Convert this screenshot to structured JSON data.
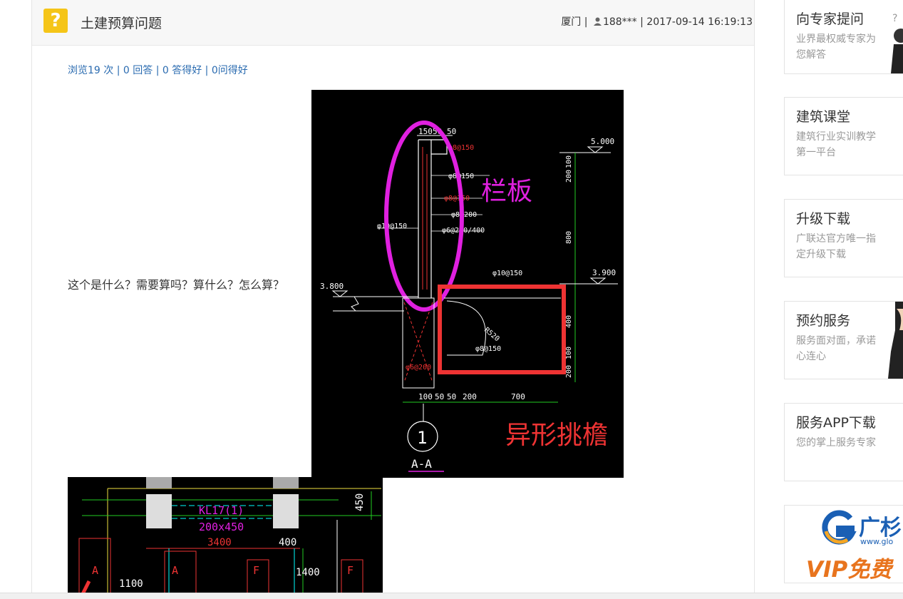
{
  "question": {
    "title": "土建预算问题",
    "location": "厦门",
    "separator1": "|",
    "user": "188***",
    "separator2": "|",
    "datetime": "2017-09-14 16:19:13",
    "stats": "浏览19 次 | 0 回答 | 0 答得好 | 0问得好",
    "body_text": "这个是什么？需要算吗？算什么？怎么算？"
  },
  "drawing1": {
    "label_railing": "栏板",
    "label_eave": "异形挑檐",
    "section": "A-A",
    "axis": "1",
    "dims_top": [
      "150",
      "50",
      "50"
    ],
    "elev_top": "5.000",
    "elev_mid": "3.900",
    "elev_left": "3.800",
    "vdims": [
      "100",
      "200",
      "800",
      "100",
      "400",
      "100",
      "200"
    ],
    "hdims": [
      "100",
      "50",
      "50",
      "200",
      "700"
    ],
    "rebar": [
      "φ8@150",
      "φ8@150",
      "φ8@200",
      "φ6@200/400",
      "φ10@150",
      "φ10@150",
      "R520",
      "φ8@150",
      "φ6@200"
    ]
  },
  "drawing2": {
    "beam": "KL17(1)",
    "beam_size": "200x450",
    "span": "3400",
    "dims": [
      "1100",
      "1400",
      "400",
      "450"
    ],
    "marks": [
      "A",
      "A",
      "F",
      "F"
    ]
  },
  "sidebar": [
    {
      "title": "向专家提问",
      "desc": "业界最权威专家为您解答",
      "art": "expert-figure"
    },
    {
      "title": "建筑课堂",
      "desc": "建筑行业实训教学第一平台",
      "art": ""
    },
    {
      "title": "升级下载",
      "desc": "广联达官方唯一指定升级下载",
      "art": ""
    },
    {
      "title": "预约服务",
      "desc": "服务面对面，承诺心连心",
      "art": "service-person"
    },
    {
      "title": "服务APP下载",
      "desc": "您的掌上服务专家",
      "art": ""
    }
  ],
  "logo": {
    "brand": "广杉",
    "url": "www.glo",
    "vip": "VIP免费"
  },
  "colors": {
    "link": "#2a6bb0",
    "magenta": "#e020e0",
    "red": "#ee3333",
    "cad_green": "#22cc22"
  }
}
